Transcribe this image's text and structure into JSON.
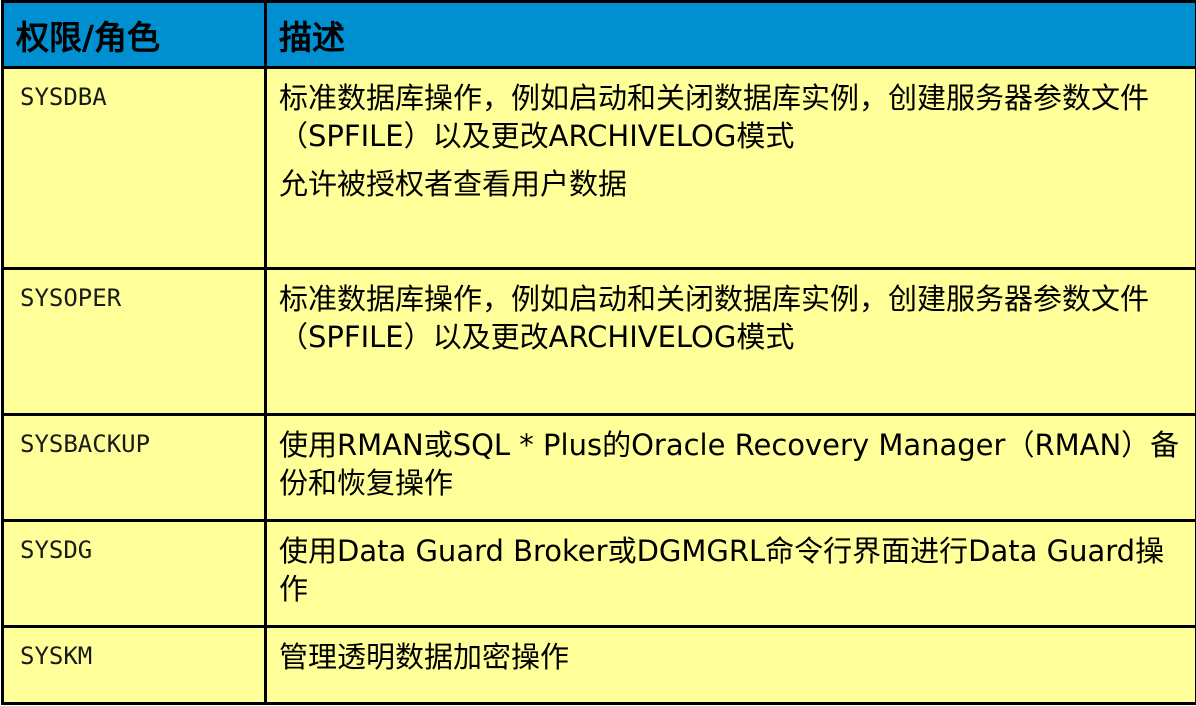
{
  "table": {
    "headers": {
      "role": "权限/角色",
      "description": "描述"
    },
    "rows": [
      {
        "role": "SYSDBA",
        "lines": [
          "标准数据库操作，例如启动和关闭数据库实例，创建服务器参数文件（SPFILE）以及更改ARCHIVELOG模式",
          "允许被授权者查看用户数据"
        ]
      },
      {
        "role": "SYSOPER",
        "lines": [
          "标准数据库操作，例如启动和关闭数据库实例，创建服务器参数文件（SPFILE）以及更改ARCHIVELOG模式"
        ]
      },
      {
        "role": "SYSBACKUP",
        "lines": [
          "使用RMAN或SQL * Plus的Oracle Recovery Manager（RMAN）备份和恢复操作"
        ]
      },
      {
        "role": "SYSDG",
        "lines": [
          "使用Data Guard Broker或DGMGRL命令行界面进行Data Guard操作"
        ]
      },
      {
        "role": "SYSKM",
        "lines": [
          "管理透明数据加密操作"
        ]
      }
    ]
  }
}
